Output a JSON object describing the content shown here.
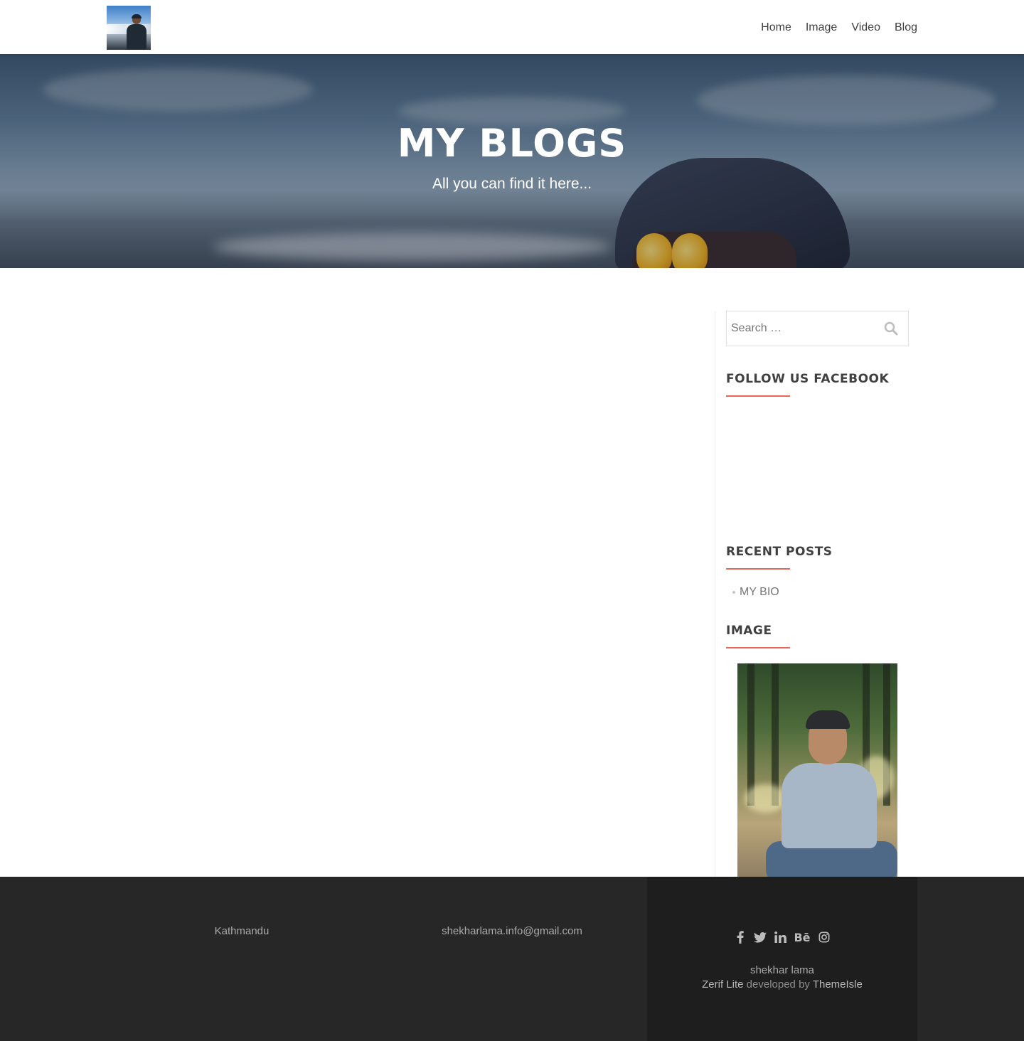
{
  "nav": {
    "items": [
      {
        "label": "Home"
      },
      {
        "label": "Image"
      },
      {
        "label": "Video"
      },
      {
        "label": "Blog"
      }
    ]
  },
  "hero": {
    "title": "MY BLOGS",
    "subtitle": "All you can find it here..."
  },
  "sidebar": {
    "search": {
      "placeholder": "Search …"
    },
    "widgets": {
      "facebook_title": "FOLLOW US FACEBOOK",
      "recent_title": "RECENT POSTS",
      "image_title": "IMAGE"
    },
    "recent_posts": [
      {
        "label": "MY BIO"
      }
    ],
    "accent_color": "#e96656"
  },
  "footer": {
    "location": "Kathmandu",
    "email": "shekharlama.info@gmail.com",
    "social_icons": [
      "facebook-icon",
      "twitter-icon",
      "linkedin-icon",
      "behance-icon",
      "instagram-icon"
    ],
    "site_name": "shekhar lama",
    "theme_name": "Zerif Lite",
    "developed_by": "developed by",
    "developer": "ThemeIsle"
  }
}
